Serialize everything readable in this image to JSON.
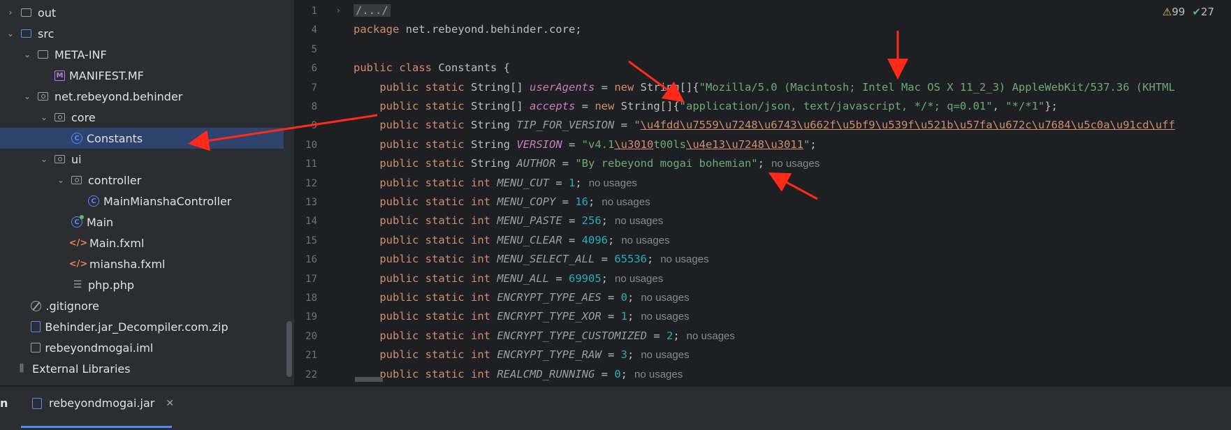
{
  "project_tree": {
    "items": [
      {
        "label": "out",
        "icon": "folder-icon",
        "chevron": "›",
        "indent": 0
      },
      {
        "label": "src",
        "icon": "source-folder-icon",
        "chevron": "⌄",
        "indent": 0
      },
      {
        "label": "META-INF",
        "icon": "folder-icon",
        "chevron": "⌄",
        "indent": 1
      },
      {
        "label": "MANIFEST.MF",
        "icon": "manifest-icon",
        "chevron": "",
        "indent": 2
      },
      {
        "label": "net.rebeyond.behinder",
        "icon": "package-icon",
        "chevron": "⌄",
        "indent": 1
      },
      {
        "label": "core",
        "icon": "package-icon",
        "chevron": "⌄",
        "indent": 2
      },
      {
        "label": "Constants",
        "icon": "class-icon",
        "chevron": "",
        "indent": 3,
        "selected": true
      },
      {
        "label": "ui",
        "icon": "package-icon",
        "chevron": "⌄",
        "indent": 2
      },
      {
        "label": "controller",
        "icon": "package-icon",
        "chevron": "⌄",
        "indent": 3
      },
      {
        "label": "MainMianshaController",
        "icon": "class-icon",
        "chevron": "",
        "indent": 4
      },
      {
        "label": "Main",
        "icon": "main-class-icon",
        "chevron": "",
        "indent": 3
      },
      {
        "label": "Main.fxml",
        "icon": "fxml-icon",
        "chevron": "",
        "indent": 3
      },
      {
        "label": "miansha.fxml",
        "icon": "fxml-icon",
        "chevron": "",
        "indent": 3
      },
      {
        "label": "php.php",
        "icon": "text-file-icon",
        "chevron": "",
        "indent": 3
      },
      {
        "label": ".gitignore",
        "icon": "ignore-icon",
        "chevron": "",
        "indent": 0.6
      },
      {
        "label": "Behinder.jar_Decompiler.com.zip",
        "icon": "zip-icon",
        "chevron": "",
        "indent": 0.6
      },
      {
        "label": "rebeyondmogai.iml",
        "icon": "iml-icon",
        "chevron": "",
        "indent": 0.6
      },
      {
        "label": "External Libraries",
        "icon": "library-icon",
        "chevron": "",
        "indent": -0.4
      }
    ]
  },
  "editor": {
    "inspections": {
      "warnings": "99",
      "ok": "27"
    },
    "line_numbers": [
      "1",
      "4",
      "5",
      "6",
      "7",
      "8",
      "9",
      "10",
      "11",
      "12",
      "13",
      "14",
      "15",
      "16",
      "17",
      "18",
      "19",
      "20",
      "21",
      "22"
    ],
    "fold_marker": "/.../",
    "package_kw": "package",
    "package_name": " net.rebeyond.behinder.core;",
    "class_decl_kw": "public class",
    "class_name": " Constants {",
    "pubstat": "public static",
    "type_string_arr": "String[]",
    "type_string": "String",
    "type_int": "int",
    "new_kw": "new",
    "line7_name": "userAgents",
    "line7_new_type": " String[]{",
    "line7_str": "\"Mozilla/5.0 (Macintosh; Intel Mac OS X 11_2_3) AppleWebKit/537.36 (",
    "line7_tail": "KHTML",
    "line8_name": "accepts",
    "line8_new_type": " String[]{",
    "line8_str": "\"application/json, text/javascript, */*; q=0.01\"",
    "line8_sep": ", ",
    "line8_str2": "\"*/*1\"",
    "line8_end": "};",
    "line9_name": "TIP_FOR_VERSION",
    "line9_quote": "\"",
    "line9_esc": "\\u4fdd\\u7559\\u7248\\u6743\\u662f\\u5bf9\\u539f\\u521b\\u57fa\\u672c\\u7684\\u5c0a\\u91cd\\uff",
    "line10_name": "VERSION",
    "line10_str1": "\"v4.1",
    "line10_esc1": "\\u3010",
    "line10_str2": "t00ls",
    "line10_esc2": "\\u4e13\\u7248\\u3011",
    "line10_str3": "\"",
    "line10_end": ";",
    "line11_name": "AUTHOR",
    "line11_str": "\"By rebeyond mogai bohemian\"",
    "line11_end": ";",
    "no_usages": "no usages",
    "int_lines": [
      {
        "name": "MENU_CUT",
        "value": "1"
      },
      {
        "name": "MENU_COPY",
        "value": "16"
      },
      {
        "name": "MENU_PASTE",
        "value": "256"
      },
      {
        "name": "MENU_CLEAR",
        "value": "4096"
      },
      {
        "name": "MENU_SELECT_ALL",
        "value": "65536"
      },
      {
        "name": "MENU_ALL",
        "value": "69905"
      },
      {
        "name": "ENCRYPT_TYPE_AES",
        "value": "0"
      },
      {
        "name": "ENCRYPT_TYPE_XOR",
        "value": "1"
      },
      {
        "name": "ENCRYPT_TYPE_CUSTOMIZED",
        "value": "2"
      },
      {
        "name": "ENCRYPT_TYPE_RAW",
        "value": "3"
      },
      {
        "name": "REALCMD_RUNNING",
        "value": "0"
      }
    ]
  },
  "bottom_bar": {
    "left_fragment": "n",
    "tab_label": "rebeyondmogai.jar",
    "tab_close": "✕"
  },
  "colors": {
    "annotation_arrow": "#ff2a1a",
    "selection": "#2e436e",
    "accent": "#548af7"
  }
}
